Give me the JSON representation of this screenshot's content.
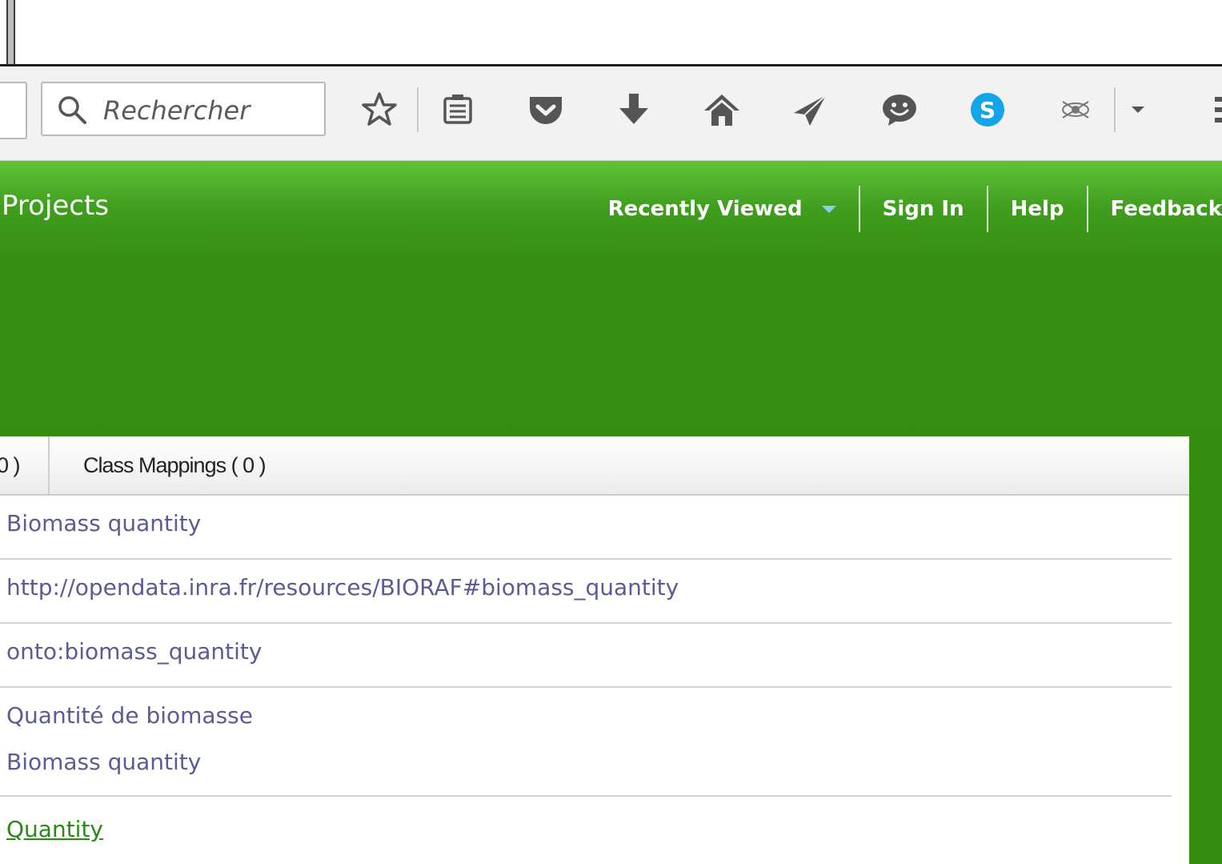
{
  "toolbar": {
    "search_placeholder": "Rechercher",
    "icons": [
      "star-icon",
      "reading-list-icon",
      "pocket-icon",
      "download-icon",
      "home-icon",
      "send-icon",
      "chat-icon",
      "skype-icon",
      "extension-icon",
      "dropdown-icon",
      "menu-icon"
    ]
  },
  "header": {
    "brand": "Projects",
    "nav": {
      "recently_viewed": "Recently Viewed",
      "sign_in": "Sign In",
      "help": "Help",
      "feedback": "Feedback"
    }
  },
  "tabs": {
    "partial_count": "0 )",
    "class_mappings": "Class Mappings ( 0 )"
  },
  "details": {
    "pref_label": "Biomass quantity",
    "id": "http://opendata.inra.fr/resources/BIORAF#biomass_quantity",
    "prefixed_id": "onto:biomass_quantity",
    "label_fr": "Quantité de biomasse",
    "label_en": "Biomass quantity",
    "parent": "Quantity"
  },
  "colors": {
    "header_green": "#368d10",
    "link_purple": "#5b5b95",
    "link_green": "#2a8a17"
  }
}
